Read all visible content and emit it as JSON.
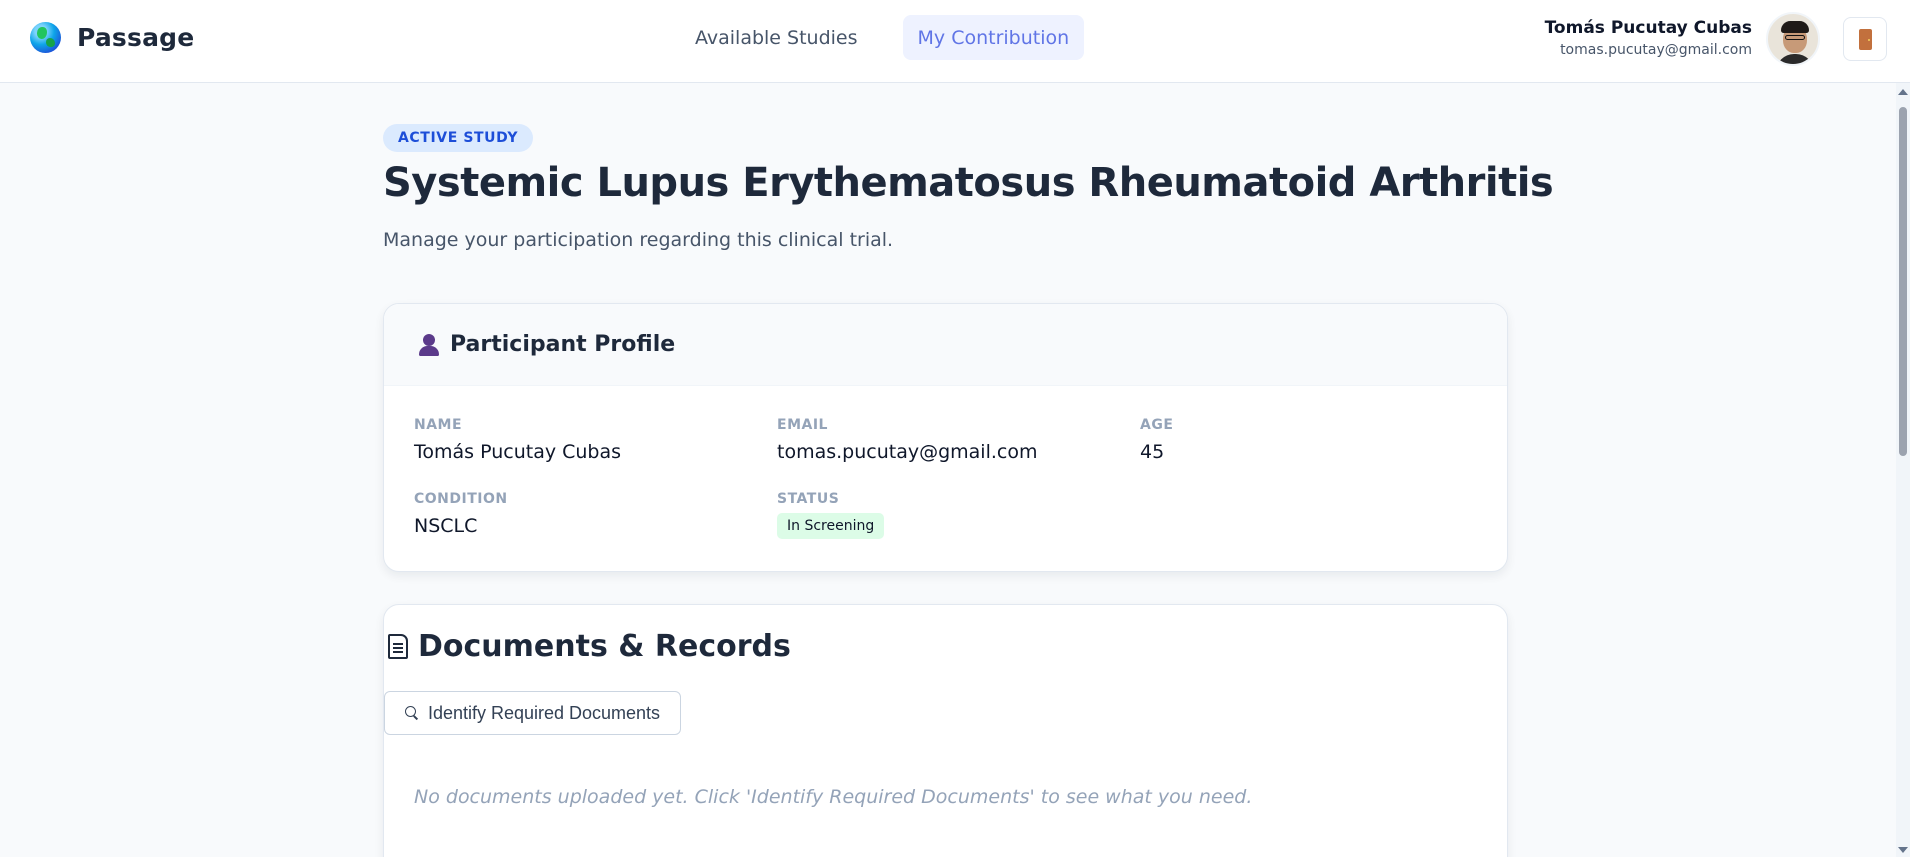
{
  "app": {
    "name": "Passage"
  },
  "nav": {
    "tabs": [
      {
        "label": "Available Studies",
        "active": false
      },
      {
        "label": "My Contribution",
        "active": true
      }
    ]
  },
  "user": {
    "name": "Tomás Pucutay Cubas",
    "email": "tomas.pucutay@gmail.com"
  },
  "study": {
    "badge": "ACTIVE STUDY",
    "title": "Systemic Lupus Erythematosus Rheumatoid Arthritis",
    "subtitle": "Manage your participation regarding this clinical trial."
  },
  "profile": {
    "title": "Participant Profile",
    "fields": {
      "name": {
        "label": "NAME",
        "value": "Tomás Pucutay Cubas"
      },
      "email": {
        "label": "EMAIL",
        "value": "tomas.pucutay@gmail.com"
      },
      "age": {
        "label": "AGE",
        "value": "45"
      },
      "condition": {
        "label": "CONDITION",
        "value": "NSCLC"
      },
      "status": {
        "label": "STATUS",
        "value": "In Screening"
      }
    }
  },
  "documents": {
    "title": "Documents & Records",
    "identify_button": "Identify Required Documents",
    "empty_message": "No documents uploaded yet. Click 'Identify Required Documents' to see what you need."
  },
  "colors": {
    "accent": "#6075e6",
    "badge_bg": "#dbeafe",
    "status_bg": "#dcfce7"
  },
  "icons": [
    "globe-icon",
    "door-icon",
    "person-icon",
    "document-icon",
    "magnifier-icon"
  ]
}
